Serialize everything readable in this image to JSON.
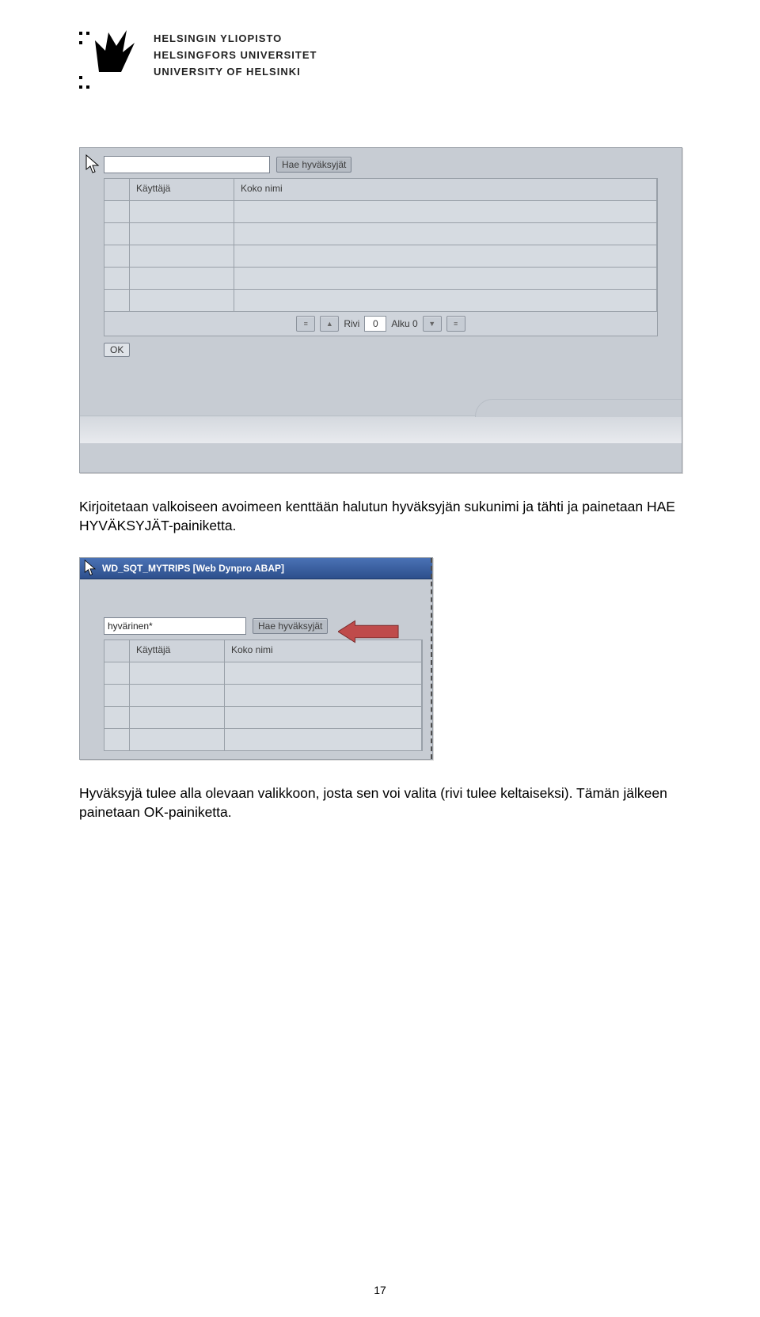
{
  "header": {
    "name_fi": "HELSINGIN YLIOPISTO",
    "name_sv": "HELSINGFORS UNIVERSITET",
    "name_en": "UNIVERSITY OF HELSINKI"
  },
  "screenshot1": {
    "search_value": "",
    "search_button": "Hae hyväksyjät",
    "col_user": "Käyttäjä",
    "col_name": "Koko nimi",
    "rivi_label": "Rivi",
    "rivi_value": "0",
    "alku_label": "Alku 0",
    "ok_label": "OK"
  },
  "para1": "Kirjoitetaan valkoiseen avoimeen kenttään halutun hyväksyjän sukunimi ja tähti ja painetaan HAE HYVÄKSYJÄT-painiketta.",
  "screenshot2": {
    "title": "WD_SQT_MYTRIPS [Web Dynpro ABAP]",
    "search_value": "hyvärinen*",
    "search_button": "Hae hyväksyjät",
    "col_user": "Käyttäjä",
    "col_name": "Koko nimi"
  },
  "para2": "Hyväksyjä tulee alla olevaan valikkoon, josta sen voi valita (rivi tulee keltaiseksi). Tämän jälkeen painetaan OK-painiketta.",
  "page_number": "17"
}
